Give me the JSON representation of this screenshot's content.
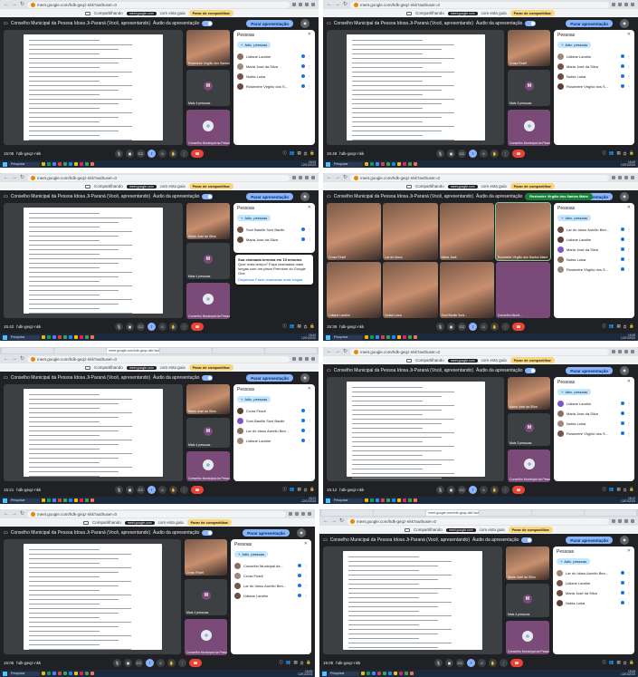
{
  "meet_url": "meet.google.com/hdk-geqz-nkk?authuser=0",
  "share_bar": {
    "label": "Compartilhando",
    "hint": "meet.google.com",
    "hint2": "com esta guia",
    "stop": "Parar de compartilhar"
  },
  "meeting_title": "Conselho Municipal da Pessoa Idosa Ji-Paraná (Você, apresentando)",
  "audio_label": "Áudio da apresentação",
  "present_button": "Parar apresentação",
  "people_title": "Pessoas",
  "add_people": "Adic. pessoas",
  "meeting_code": "hdk-geqz-nkk",
  "more_people": "Mais 4 pessoas",
  "more_people_b": "Mais 3 pessoas",
  "taskbar_search": "Pesquisar",
  "colors": {
    "meet_bg": "#202124",
    "accent": "#8ab4f8",
    "end_call": "#ea4335",
    "stop_share": "#f9d67a",
    "purple_tile": "#7a4a79"
  },
  "shots": [
    {
      "time": "15:05",
      "clock": "15:05",
      "date": "12/01/2024",
      "tile_name": "Rosimeire Virgílio dos Santos M...",
      "participants": [
        "Lidiane Landim",
        "Maria José da Silva",
        "Nubia Luisa",
        "Rosimeire Virgílio dos S..."
      ],
      "tile2": "Conselho Municipal da Pessoa..."
    },
    {
      "time": "15:49",
      "clock": "15:49",
      "date": "12/01/2024",
      "tile_name": "Cross Fearll",
      "participants": [
        "Lidiane Landim",
        "Maria José da Silva",
        "Nubia Luisa",
        "Rosimeire Virgílio dos S..."
      ],
      "tile2": "Conselho Municipal da Pessoa..."
    },
    {
      "time": "15:42",
      "clock": "15:42",
      "date": "12/01/2024",
      "tile_name": "Maria José da Silva",
      "participants": [
        "Soni Baniile Soni Banile",
        "Maria Jose da Silva"
      ],
      "tile2": "Conselho Municipal da Pessoa...",
      "toast": [
        "Sua chamada termina em 15 minutos",
        "Quer mais tempo? Faça chamadas mais longas com um plano Premium do Google One."
      ],
      "toast_dismiss": "Dispensar",
      "toast_longer": "Fazer chamadas mais longas"
    },
    {
      "time": "15:39",
      "clock": "15:39",
      "date": "12/01/2024",
      "banner": "Rosimeire Virgílio dos Santos Maire",
      "gallery_names": [
        "Cross Fearll",
        "Lar do Idoso",
        "Maria José",
        "Rosimeire Virgílio dos Santos Maire",
        "Lidiane Landim",
        "Nubia Luisa",
        "Soni Banile Soni...",
        "Conselho Munti..."
      ],
      "participants": [
        "Lar do Idoso Aurelio Ben...",
        "Lidiane Landim",
        "Maria José da Silva",
        "Nubia Luisa",
        "Rosimeire Virgílio dos S..."
      ]
    },
    {
      "time": "15:21",
      "clock": "15:21",
      "date": "12/01/2024",
      "tile_name": "Maria José da Silva",
      "participants": [
        "Cross Fearll",
        "Soni Baniile Soni Banile",
        "Lar do Idoso Aurelio Ben...",
        "Lidiane Landim"
      ],
      "tile2": "Conselho Municipal da Pessoa..."
    },
    {
      "time": "15:12",
      "clock": "15:12",
      "date": "12/01/2024",
      "tile_name": "Maria José da Silva",
      "participants": [
        "Lidiane Landim",
        "Maria José da Silva",
        "Nubia Luisa",
        "Rosimeire Virgílio dos S..."
      ],
      "tile2": "Conselho Municipal da Pessoa..."
    },
    {
      "time": "15:05",
      "clock": "15:05",
      "date": "12/01/2024",
      "tile_name": "Cross Fearll",
      "participants": [
        "Conselho Municipal da...",
        "Cross Fearll",
        "Lar do Idoso Aurelio Ben...",
        "Lidiane Landim"
      ],
      "tile2": "Conselho Municipal da Pessoa..."
    },
    {
      "time": "15:05",
      "clock": "15:05",
      "date": "12/01/2024",
      "tile_name": "Maria José da Silva",
      "participants": [
        "Lar do Idoso Aurelio Ben...",
        "Lidiane Landim",
        "Maria José da Silva",
        "Nubia Luisa"
      ],
      "tile2": "Conselho Municipal da Pessoa..."
    }
  ]
}
